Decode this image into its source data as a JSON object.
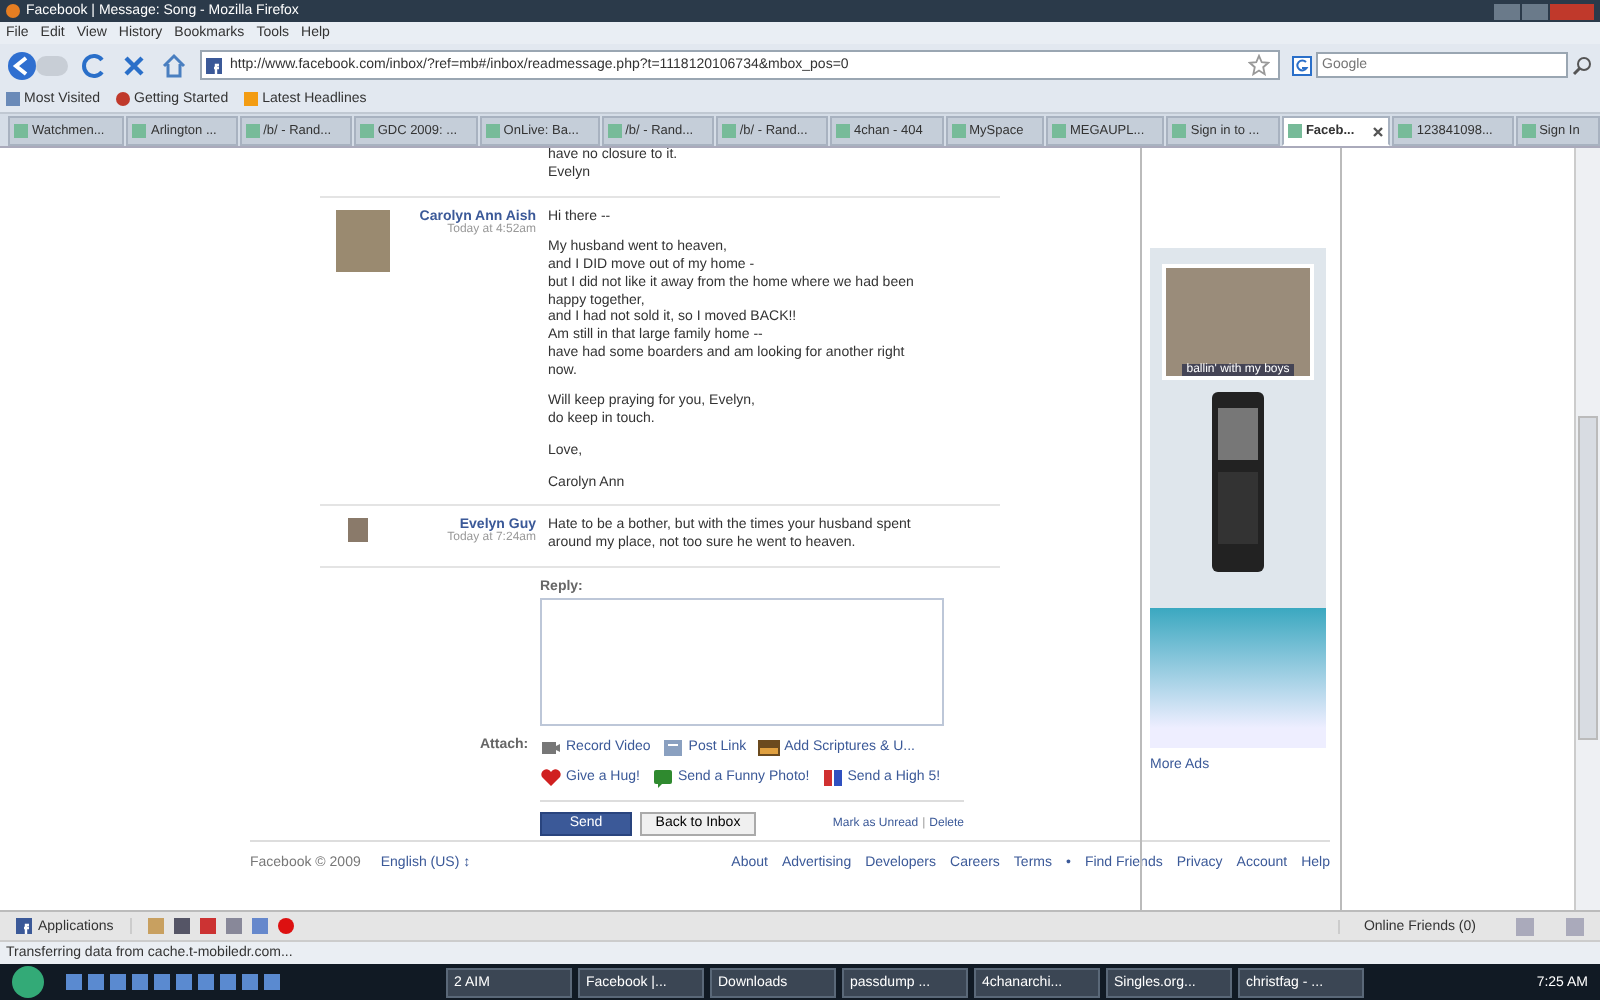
{
  "window": {
    "title": "Facebook | Message: Song - Mozilla Firefox"
  },
  "menu": [
    "File",
    "Edit",
    "View",
    "History",
    "Bookmarks",
    "Tools",
    "Help"
  ],
  "address_bar": {
    "value": "http://www.facebook.com/inbox/?ref=mb#/inbox/readmessage.php?t=1118120106734&mbox_pos=0"
  },
  "search": {
    "placeholder": "Google"
  },
  "bookmarks": [
    "Most Visited",
    "Getting Started",
    "Latest Headlines"
  ],
  "tabs": [
    {
      "label": "Watchmen...",
      "selected": false
    },
    {
      "label": "Arlington ...",
      "selected": false
    },
    {
      "label": "/b/ - Rand...",
      "selected": false
    },
    {
      "label": "GDC 2009: ...",
      "selected": false
    },
    {
      "label": "OnLive: Ba...",
      "selected": false
    },
    {
      "label": "/b/ - Rand...",
      "selected": false
    },
    {
      "label": "/b/ - Rand...",
      "selected": false
    },
    {
      "label": "4chan - 404",
      "selected": false
    },
    {
      "label": "MySpace",
      "selected": false
    },
    {
      "label": "MEGAUPL...",
      "selected": false
    },
    {
      "label": "Sign in to ...",
      "selected": false
    },
    {
      "label": "Faceb...",
      "selected": true
    },
    {
      "label": "123841098...",
      "selected": false
    },
    {
      "label": "Sign In",
      "selected": false
    }
  ],
  "messages": [
    {
      "paragraphs": [
        "have no closure to it.\nEvelyn"
      ]
    },
    {
      "sender": "Carolyn Ann Aish",
      "time": "Today at 4:52am",
      "paragraphs": [
        "Hi there --",
        "My husband went to heaven,\nand I DID move out of my home -\nbut I did not like it away from the home where we had been\nhappy together,\nand I had not sold it, so I moved BACK!!\nAm still in that large family home --\nhave had some boarders and am looking for another right\nnow.",
        "Will keep praying for you, Evelyn,\ndo keep in touch.",
        "Love,",
        "Carolyn Ann"
      ]
    },
    {
      "sender": "Evelyn Guy",
      "time": "Today at 7:24am",
      "paragraphs": [
        "Hate to be a bother, but with the times your husband spent\naround my place, not too sure he went to heaven."
      ]
    }
  ],
  "reply": {
    "label": "Reply:",
    "attach_label": "Attach:",
    "attachments": [
      {
        "kind": "video",
        "label": "Record Video"
      },
      {
        "kind": "link",
        "label": "Post Link"
      },
      {
        "kind": "scripture",
        "label": "Add Scriptures & U..."
      },
      {
        "kind": "hug",
        "label": "Give a Hug!"
      },
      {
        "kind": "photo",
        "label": "Send a Funny Photo!"
      },
      {
        "kind": "highfive",
        "label": "Send a High 5!"
      }
    ],
    "send": "Send",
    "back": "Back to Inbox",
    "mark_unread": "Mark as Unread",
    "separator": "|",
    "delete": "Delete"
  },
  "ad": {
    "photo_caption": "ballin' with my boys",
    "more_ads": "More Ads"
  },
  "footer": {
    "copyright": "Facebook © 2009",
    "language": "English (US) ↕",
    "links": [
      "About",
      "Advertising",
      "Developers",
      "Careers",
      "Terms",
      "•",
      "Find Friends",
      "Privacy",
      "Account",
      "Help"
    ]
  },
  "chat_bar": {
    "applications": "Applications",
    "online_friends": "Online Friends (0)"
  },
  "status_bar": "Transferring data from cache.t-mobiledr.com...",
  "taskbar": {
    "items": [
      "2 AIM",
      "Facebook |...",
      "Downloads",
      "passdump ...",
      "4chanarchi...",
      "Singles.org...",
      "christfag - ..."
    ],
    "clock": "7:25 AM"
  }
}
